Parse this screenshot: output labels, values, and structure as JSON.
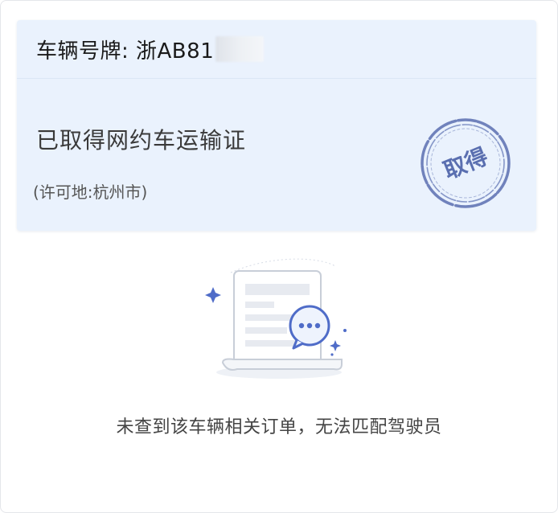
{
  "vehicle": {
    "plate_label": "车辆号牌: 浙AB81"
  },
  "permit": {
    "status": "已取得网约车运输证",
    "place": "(许可地:杭州市)",
    "stamp_text": "取得"
  },
  "empty_state": {
    "message": "未查到该车辆相关订单，无法匹配驾驶员"
  },
  "colors": {
    "card_bg": "#eaf2fd",
    "stamp": "#5a6fb0",
    "accent": "#4c6fd6"
  }
}
